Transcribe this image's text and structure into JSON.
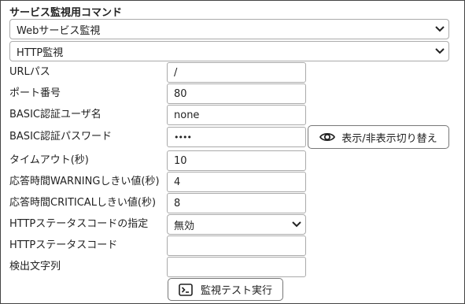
{
  "section_title": "サービス監視用コマンド",
  "service_select": {
    "value": "Webサービス監視"
  },
  "monitor_select": {
    "value": "HTTP監視"
  },
  "fields": {
    "url_path": {
      "label": "URLパス",
      "value": "/"
    },
    "port": {
      "label": "ポート番号",
      "value": "80"
    },
    "basic_user": {
      "label": "BASIC認証ユーザ名",
      "value": "none"
    },
    "basic_password": {
      "label": "BASIC認証パスワード",
      "value": "••••"
    },
    "timeout": {
      "label": "タイムアウト(秒)",
      "value": "10"
    },
    "warning": {
      "label": "応答時間WARNINGしきい値(秒)",
      "value": "4"
    },
    "critical": {
      "label": "応答時間CRITICALしきい値(秒)",
      "value": "8"
    },
    "status_spec": {
      "label": "HTTPステータスコードの指定",
      "value": "無効"
    },
    "status_code": {
      "label": "HTTPステータスコード",
      "value": ""
    },
    "search_string": {
      "label": "検出文字列",
      "value": ""
    }
  },
  "toggle_password_button": {
    "label": "表示/非表示切り替え",
    "icon": "eye-icon"
  },
  "run_test_button": {
    "label": "監視テスト実行",
    "icon": "terminal-icon"
  }
}
